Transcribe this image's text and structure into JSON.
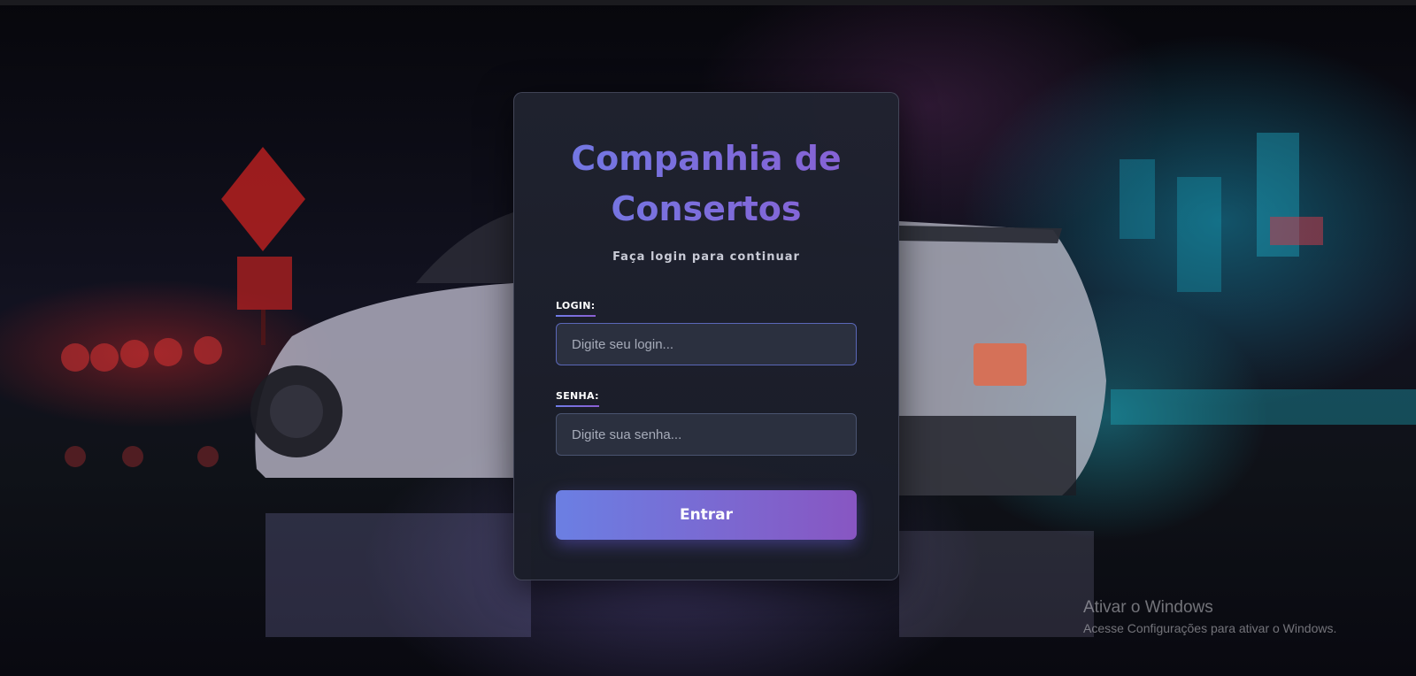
{
  "login_card": {
    "title": "Companhia de Consertos",
    "subtitle": "Faça login para continuar",
    "login_label": "LOGIN:",
    "login_placeholder": "Digite seu login...",
    "password_label": "SENHA:",
    "password_placeholder": "Digite sua senha...",
    "submit_label": "Entrar"
  },
  "watermark": {
    "line1": "Ativar o Windows",
    "line2": "Acesse Configurações para ativar o Windows."
  },
  "colors": {
    "accent_start": "#6b7fe3",
    "accent_end": "#8856c2",
    "card_bg": "#20232f"
  }
}
